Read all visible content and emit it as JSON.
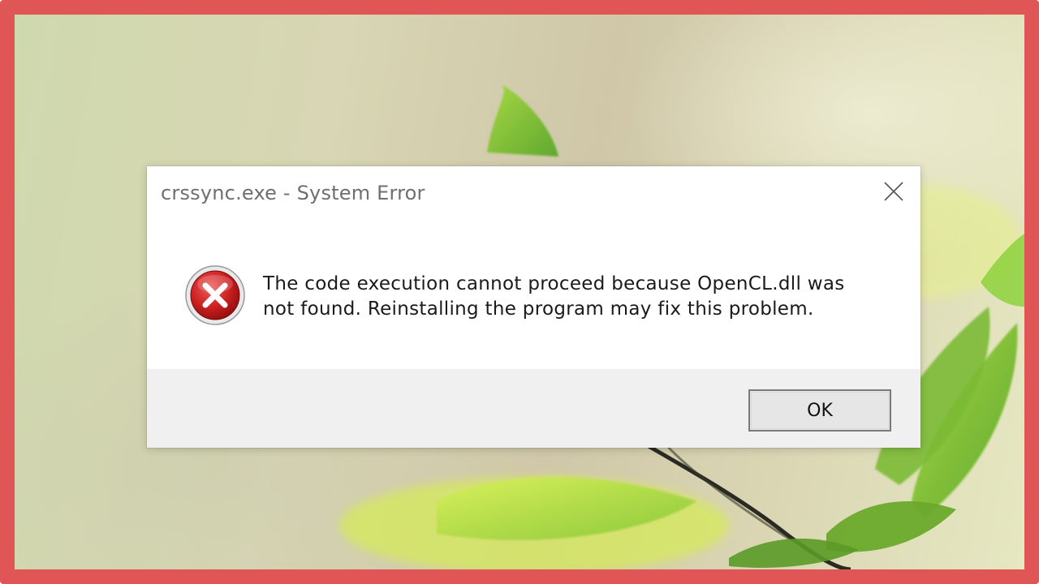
{
  "dialog": {
    "title": "crssync.exe - System Error",
    "icon": "error-icon",
    "message_line1": "The code execution cannot proceed because OpenCL.dll was",
    "message_line2": "not found. Reinstalling the program may fix this problem.",
    "ok_label": "OK",
    "close_icon": "close-icon"
  },
  "colors": {
    "frame_border": "#e05656",
    "dialog_background": "#ffffff",
    "footer_background": "#f0f0f0",
    "error_red": "#c81e1e"
  }
}
